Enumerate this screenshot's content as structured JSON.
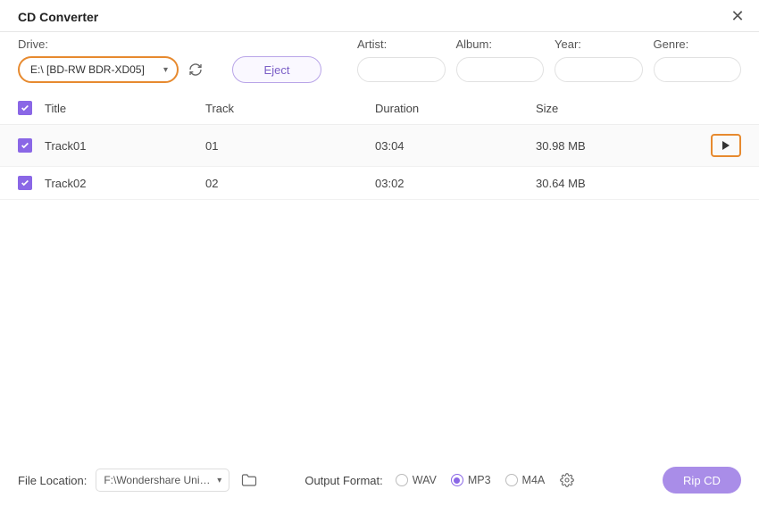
{
  "title": "CD Converter",
  "labels": {
    "drive": "Drive:",
    "artist": "Artist:",
    "album": "Album:",
    "year": "Year:",
    "genre": "Genre:"
  },
  "drive": {
    "selected": "E:\\ [BD-RW   BDR-XD05]"
  },
  "eject": "Eject",
  "columns": {
    "title": "Title",
    "track": "Track",
    "duration": "Duration",
    "size": "Size"
  },
  "tracks": [
    {
      "title": "Track01",
      "track": "01",
      "duration": "03:04",
      "size": "30.98 MB",
      "checked": true,
      "playable": true
    },
    {
      "title": "Track02",
      "track": "02",
      "duration": "03:02",
      "size": "30.64 MB",
      "checked": true,
      "playable": false
    }
  ],
  "footer": {
    "fileLocationLabel": "File Location:",
    "fileLocation": "F:\\Wondershare UniConverter",
    "outputFormatLabel": "Output Format:",
    "formats": {
      "wav": "WAV",
      "mp3": "MP3",
      "m4a": "M4A",
      "selected": "mp3"
    },
    "rip": "Rip CD"
  }
}
